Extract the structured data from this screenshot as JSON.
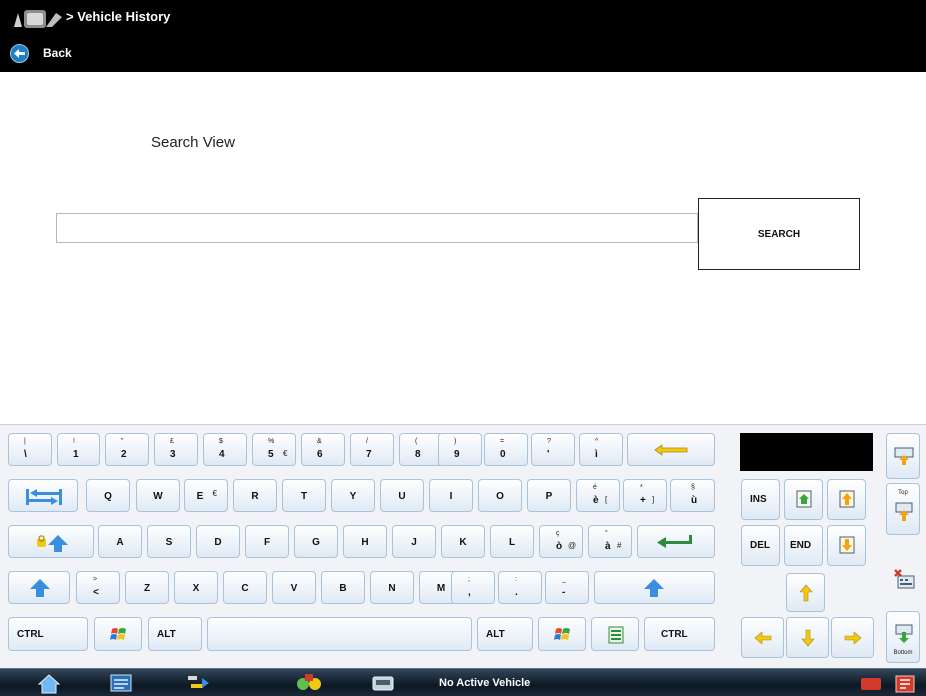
{
  "header": {
    "breadcrumb": "> Vehicle History",
    "back_label": "Back"
  },
  "search": {
    "title": "Search View",
    "input_value": "",
    "button_label": "SEARCH"
  },
  "keyboard": {
    "row1": [
      {
        "top": "|",
        "main": "\\"
      },
      {
        "top": "!",
        "main": "1"
      },
      {
        "top": "\"",
        "main": "2"
      },
      {
        "top": "£",
        "main": "3"
      },
      {
        "top": "$",
        "main": "4"
      },
      {
        "top": "%",
        "main": "5",
        "alt": "€"
      },
      {
        "top": "&",
        "main": "6"
      },
      {
        "top": "/",
        "main": "7"
      },
      {
        "top": "(",
        "main": "8"
      },
      {
        "top": ")",
        "main": "9"
      },
      {
        "top": "=",
        "main": "0"
      },
      {
        "top": "?",
        "main": "'"
      },
      {
        "top": "^",
        "main": "ì"
      }
    ],
    "row2": [
      {
        "main": "Q"
      },
      {
        "main": "W"
      },
      {
        "main": "E",
        "alt": "€"
      },
      {
        "main": "R"
      },
      {
        "main": "T"
      },
      {
        "main": "Y"
      },
      {
        "main": "U"
      },
      {
        "main": "I"
      },
      {
        "main": "O"
      },
      {
        "main": "P"
      },
      {
        "top": "é",
        "main": "è",
        "alt": "["
      },
      {
        "top": "*",
        "main": "+",
        "alt": "]"
      },
      {
        "top": "§",
        "main": "ù"
      }
    ],
    "row3": [
      {
        "main": "A"
      },
      {
        "main": "S"
      },
      {
        "main": "D"
      },
      {
        "main": "F"
      },
      {
        "main": "G"
      },
      {
        "main": "H"
      },
      {
        "main": "J"
      },
      {
        "main": "K"
      },
      {
        "main": "L"
      },
      {
        "top": "ç",
        "main": "ò",
        "alt": "@"
      },
      {
        "top": "°",
        "main": "à",
        "alt": "#"
      }
    ],
    "row4": [
      {
        "top": ">",
        "main": "<"
      },
      {
        "main": "Z"
      },
      {
        "main": "X"
      },
      {
        "main": "C"
      },
      {
        "main": "V"
      },
      {
        "main": "B"
      },
      {
        "main": "N"
      },
      {
        "main": "M"
      },
      {
        "top": ";",
        "main": ","
      },
      {
        "top": ":",
        "main": "."
      },
      {
        "top": "_",
        "main": "-"
      }
    ],
    "ctrl_label": "CTRL",
    "alt_label": "ALT",
    "ins_label": "INS",
    "del_label": "DEL",
    "end_label": "END",
    "top_label": "Top",
    "bottom_label": "Bottom"
  },
  "taskbar": {
    "status": "No Active Vehicle"
  },
  "colors": {
    "titlebar": "#000000",
    "key_border": "#a8c4dd",
    "arrow_blue": "#3a8ee0",
    "arrow_yellow": "#f3c815",
    "return_green": "#2e8b3d"
  }
}
